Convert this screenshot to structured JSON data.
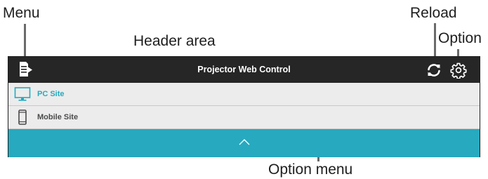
{
  "callouts": {
    "menu": "Menu",
    "header_area": "Header area",
    "reload": "Reload",
    "option": "Option",
    "option_menu": "Option menu"
  },
  "header": {
    "title": "Projector Web Control",
    "menu_icon": "document-arrow-icon",
    "reload_icon": "reload-icon",
    "option_icon": "gear-icon"
  },
  "option_menu": {
    "items": [
      {
        "label": "PC Site",
        "icon": "monitor-icon",
        "active": true
      },
      {
        "label": "Mobile Site",
        "icon": "smartphone-icon",
        "active": false
      }
    ],
    "collapse_icon": "chevron-up-icon"
  },
  "colors": {
    "header_bg": "#262626",
    "accent": "#27a9bf",
    "menu_bg": "#ececec",
    "inactive_text": "#4a4a4a",
    "leader_line": "#6b6b6b"
  }
}
